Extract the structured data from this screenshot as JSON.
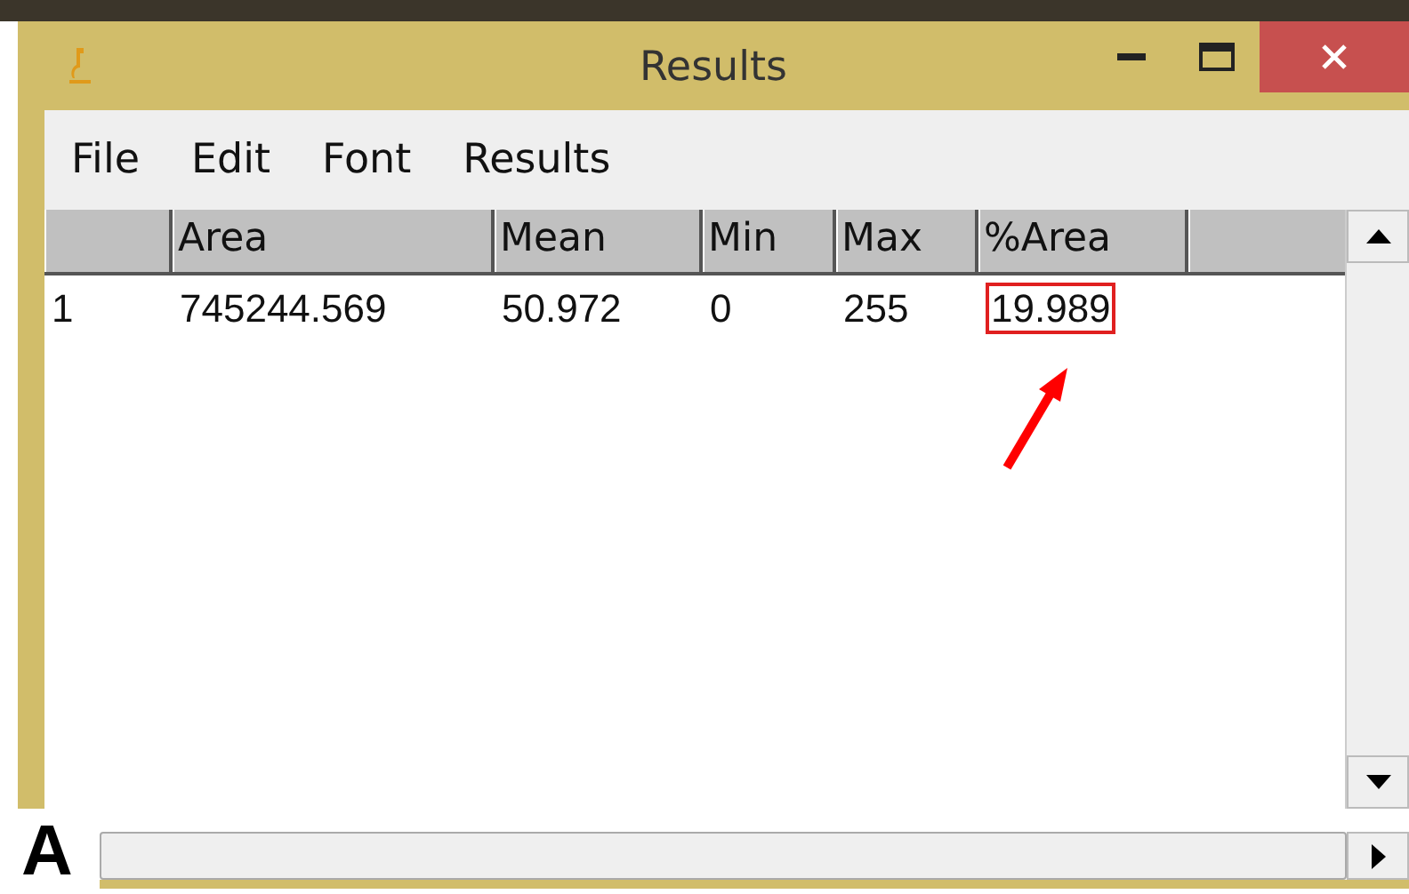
{
  "window": {
    "title": "Results"
  },
  "menu": [
    "File",
    "Edit",
    "Font",
    "Results"
  ],
  "table": {
    "columns": [
      "",
      "Area",
      "Mean",
      "Min",
      "Max",
      "%Area"
    ],
    "rows": [
      [
        {
          "text": "1",
          "highlighted": false
        },
        {
          "text": "745244.569",
          "highlighted": false
        },
        {
          "text": "50.972",
          "highlighted": false
        },
        {
          "text": "0",
          "highlighted": false
        },
        {
          "text": "255",
          "highlighted": false
        },
        {
          "text": "19.989",
          "highlighted": true
        }
      ]
    ]
  },
  "panel_label": "A"
}
